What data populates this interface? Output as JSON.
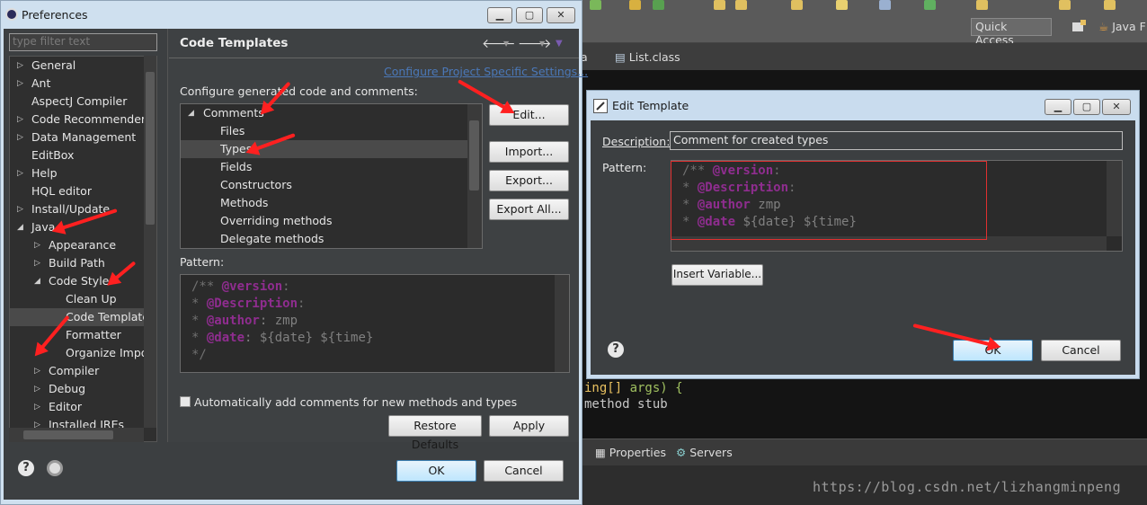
{
  "ide": {
    "quick_access": "Quick Access",
    "perspective": "Java F",
    "tab_partial": "a",
    "tab_list": "List.class",
    "code_line1_pre": "ing[] ",
    "code_line1_post": "args) {",
    "code_line2": "method stub",
    "bottom_tabs": [
      "Properties",
      "Servers"
    ],
    "watermark": "https://blog.csdn.net/lizhangminpeng"
  },
  "preferences": {
    "title": "Preferences",
    "filter_placeholder": "type filter text",
    "tree": [
      {
        "label": "General",
        "level": 0,
        "caret": "▷"
      },
      {
        "label": "Ant",
        "level": 0,
        "caret": "▷"
      },
      {
        "label": "AspectJ Compiler",
        "level": 0,
        "caret": ""
      },
      {
        "label": "Code Recommenders",
        "level": 0,
        "caret": "▷"
      },
      {
        "label": "Data Management",
        "level": 0,
        "caret": "▷"
      },
      {
        "label": "EditBox",
        "level": 0,
        "caret": ""
      },
      {
        "label": "Help",
        "level": 0,
        "caret": "▷"
      },
      {
        "label": "HQL editor",
        "level": 0,
        "caret": ""
      },
      {
        "label": "Install/Update",
        "level": 0,
        "caret": "▷"
      },
      {
        "label": "Java",
        "level": 0,
        "caret": "◢"
      },
      {
        "label": "Appearance",
        "level": 1,
        "caret": "▷"
      },
      {
        "label": "Build Path",
        "level": 1,
        "caret": "▷"
      },
      {
        "label": "Code Style",
        "level": 1,
        "caret": "◢"
      },
      {
        "label": "Clean Up",
        "level": 2,
        "caret": ""
      },
      {
        "label": "Code Template",
        "level": 2,
        "caret": "",
        "selected": true
      },
      {
        "label": "Formatter",
        "level": 2,
        "caret": ""
      },
      {
        "label": "Organize Impo",
        "level": 2,
        "caret": ""
      },
      {
        "label": "Compiler",
        "level": 1,
        "caret": "▷"
      },
      {
        "label": "Debug",
        "level": 1,
        "caret": "▷"
      },
      {
        "label": "Editor",
        "level": 1,
        "caret": "▷"
      },
      {
        "label": "Installed JREs",
        "level": 1,
        "caret": "▷"
      }
    ],
    "page_title": "Code Templates",
    "configure_link": "Configure Project Specific Settings...",
    "configure_label": "Configure generated code and comments:",
    "templates": [
      {
        "label": "Comments",
        "level": 0,
        "caret": "◢"
      },
      {
        "label": "Files",
        "level": 1
      },
      {
        "label": "Types",
        "level": 1,
        "selected": true
      },
      {
        "label": "Fields",
        "level": 1
      },
      {
        "label": "Constructors",
        "level": 1
      },
      {
        "label": "Methods",
        "level": 1
      },
      {
        "label": "Overriding methods",
        "level": 1
      },
      {
        "label": "Delegate methods",
        "level": 1
      }
    ],
    "buttons": {
      "edit": "Edit...",
      "import": "Import...",
      "export": "Export...",
      "export_all": "Export All..."
    },
    "pattern_label": "Pattern:",
    "pattern": {
      "open": "/** ",
      "version_tag": "@version",
      "colon": ":",
      "star": "* ",
      "description_tag": "@Description",
      "author_tag": "@author",
      "author_val": ": zmp",
      "date_tag": "@date",
      "date_val": ": ${date} ${time}",
      "close": "*/"
    },
    "auto_comments": "Automatically add comments for new methods and types",
    "restore_defaults": "Restore Defaults",
    "apply": "Apply",
    "ok": "OK",
    "cancel": "Cancel",
    "help": "?"
  },
  "edit_template": {
    "title": "Edit Template",
    "description_label": "Description:",
    "description_value": "Comment for created types",
    "pattern_label": "Pattern:",
    "insert_variable": "Insert Variable...",
    "ok": "OK",
    "cancel": "Cancel",
    "help": "?",
    "author_val": " zmp",
    "date_val": " ${date} ${time}"
  },
  "colors": {
    "annotation": "#ff2020",
    "tag": "#8f2d8f",
    "link": "#4b78b8"
  }
}
